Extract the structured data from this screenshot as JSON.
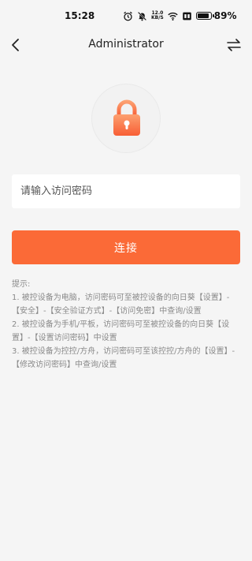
{
  "status_bar": {
    "time": "15:28",
    "net_speed_value": "12.0",
    "net_speed_unit": "KB/S",
    "battery_percent": "89%",
    "battery_level": 0.89
  },
  "nav": {
    "title": "Administrator"
  },
  "form": {
    "password_placeholder": "请输入访问密码",
    "connect_label": "连接"
  },
  "tips": {
    "heading": "提示:",
    "items": [
      "1. 被控设备为电脑，访问密码可至被控设备的向日葵【设置】-【安全】-【安全验证方式】-【访问免密】中查询/设置",
      "2. 被控设备为手机/平板，访问密码可至被控设备的向日葵【设置】-【设置访问密码】中设置",
      "3. 被控设备为控控/方舟，访问密码可至该控控/方舟的【设置】-【修改访问密码】中查询/设置"
    ]
  },
  "colors": {
    "accent": "#fb6a37",
    "lock_gradient_top": "#fca070",
    "lock_gradient_bottom": "#f85e35",
    "background": "#f5f5f5"
  },
  "icons": [
    "back-arrow-icon",
    "switch-icon",
    "lock-icon",
    "alarm-icon",
    "mute-icon",
    "wifi-icon",
    "sim-icon",
    "battery-icon"
  ]
}
